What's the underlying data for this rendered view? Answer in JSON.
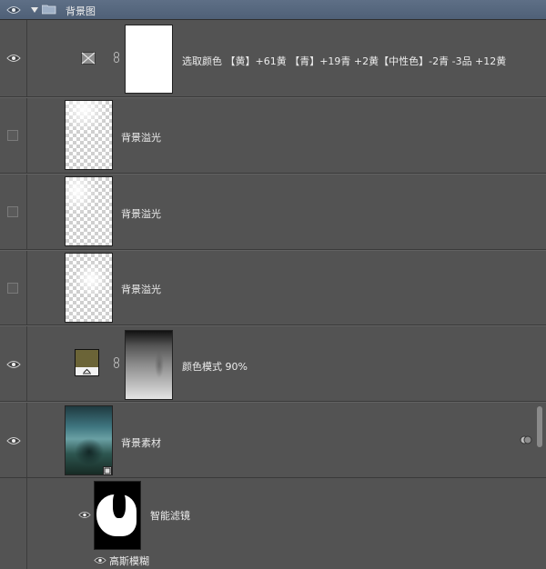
{
  "group": {
    "name": "背景图"
  },
  "layers": [
    {
      "name": "选取颜色 【黄】+61黄 【青】+19青 +2黄【中性色】-2青 -3品 +12黄",
      "visible": true,
      "type": "selective-color-adjustment"
    },
    {
      "name": "背景溢光",
      "visible": false,
      "type": "pixel"
    },
    {
      "name": "背景溢光",
      "visible": false,
      "type": "pixel"
    },
    {
      "name": "背景溢光",
      "visible": false,
      "type": "pixel"
    },
    {
      "name": "颜色模式 90%",
      "visible": true,
      "type": "solid-color-fill",
      "fill_color": "#6b6437"
    },
    {
      "name": "背景素材",
      "visible": true,
      "type": "smart-object"
    }
  ],
  "smart_filters": {
    "label": "智能滤镜",
    "visible": true
  },
  "filters": [
    {
      "name": "高斯模糊",
      "visible": true
    }
  ],
  "colors": {
    "panel_bg": "#535353",
    "header_bg": "#56677e",
    "separator": "#3a3a3a",
    "text": "#ececec"
  }
}
